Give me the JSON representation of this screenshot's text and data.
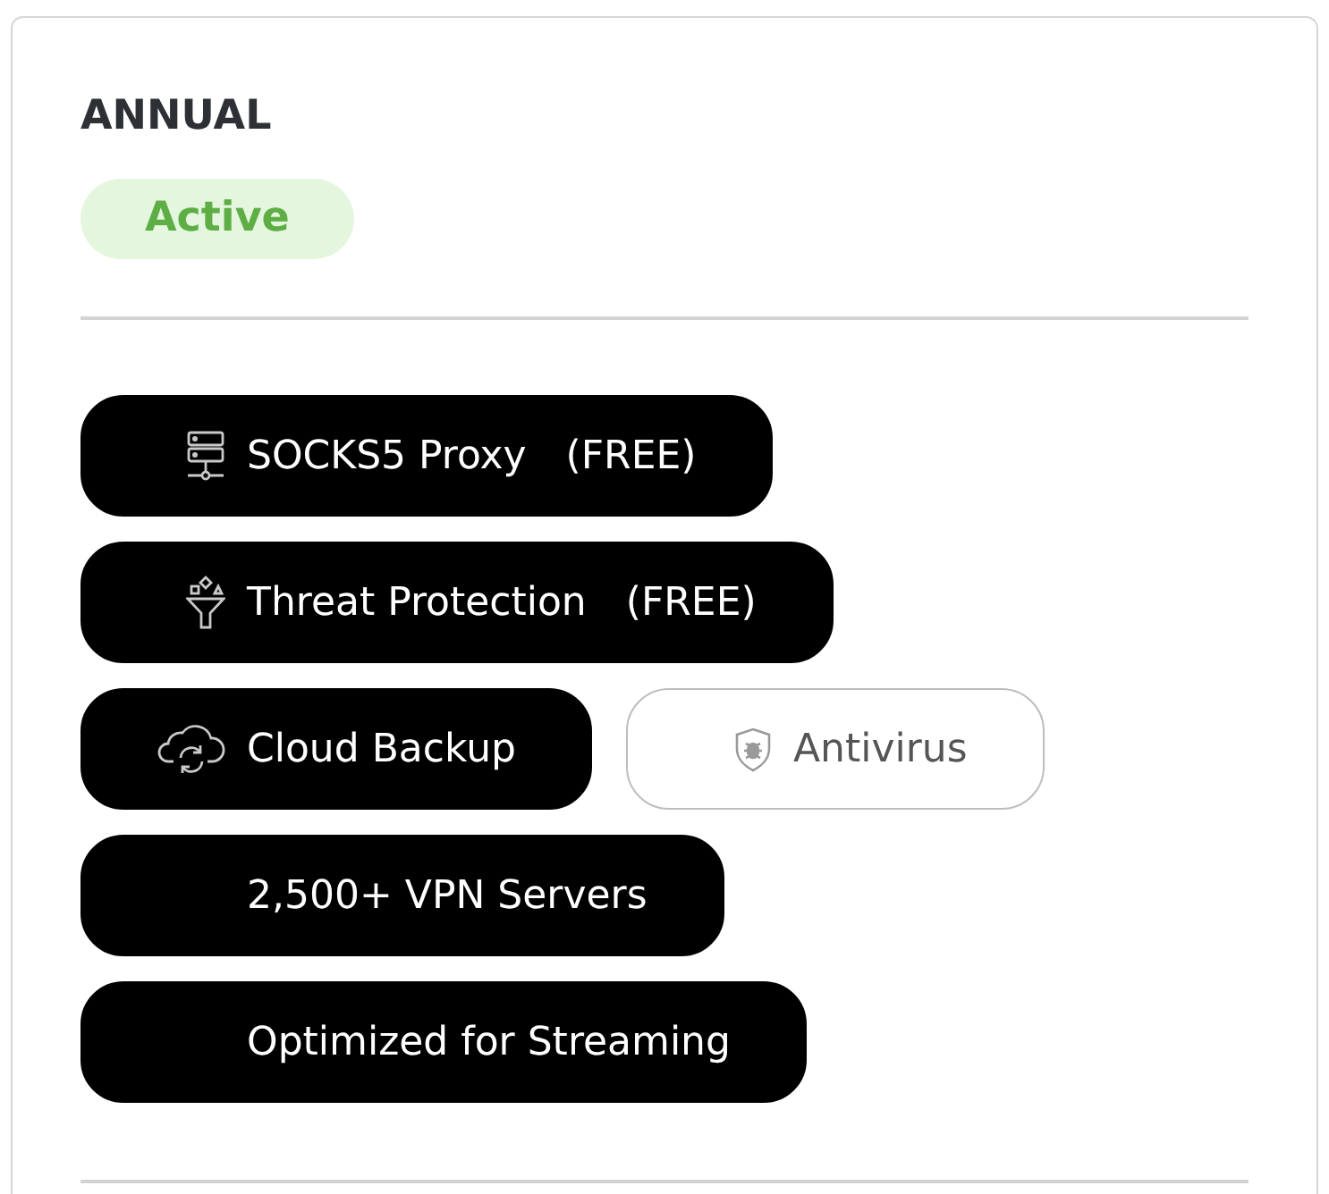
{
  "plan": {
    "title": "ANNUAL",
    "status": "Active"
  },
  "features": [
    {
      "label": "SOCKS5 Proxy",
      "note": "(FREE)",
      "included": true
    },
    {
      "label": "Threat Protection",
      "note": "(FREE)",
      "included": true
    },
    {
      "label": "Cloud Backup",
      "included": true
    },
    {
      "label": "Antivirus",
      "included": false
    },
    {
      "label": "2,500+ VPN Servers",
      "included": true
    },
    {
      "label": "Optimized for Streaming",
      "included": true
    }
  ]
}
